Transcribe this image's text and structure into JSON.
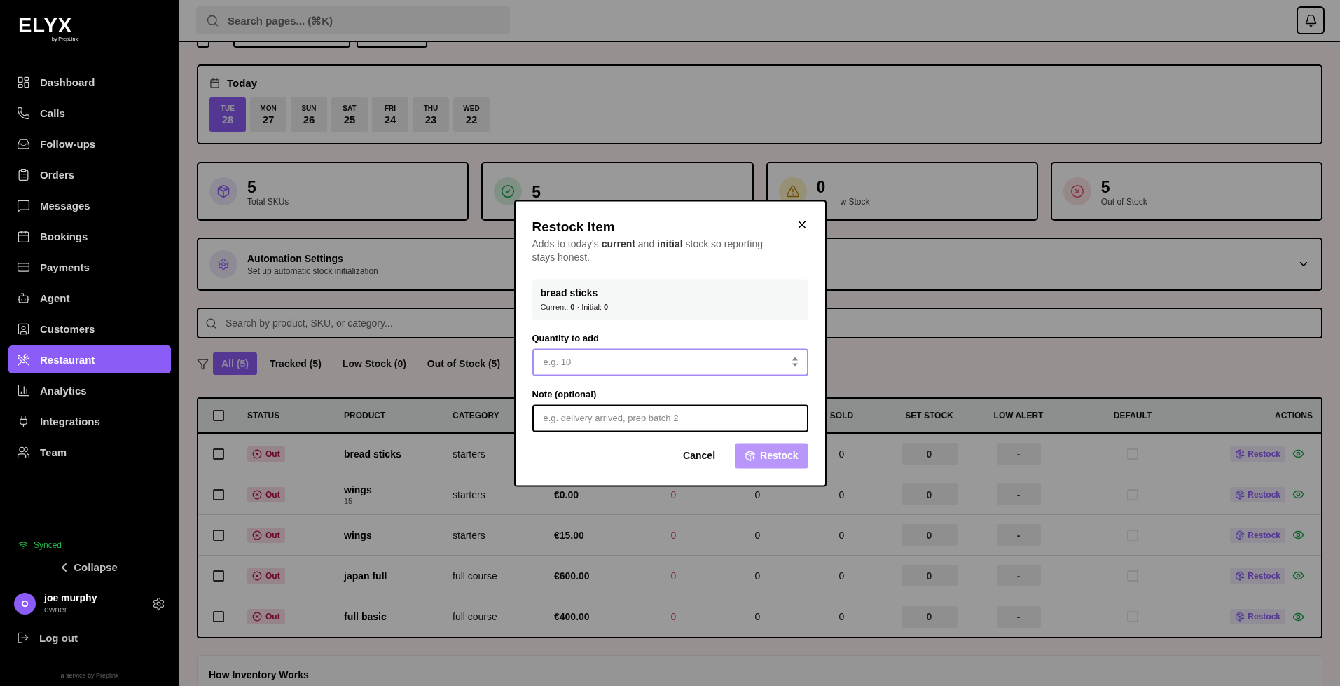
{
  "sidebar": {
    "logo": "ELYX",
    "logo_sub": "by PrepLink",
    "items": [
      {
        "label": "Dashboard",
        "selected": false
      },
      {
        "label": "Calls",
        "selected": false
      },
      {
        "label": "Follow-ups",
        "selected": false
      },
      {
        "label": "Orders",
        "selected": false
      },
      {
        "label": "Messages",
        "selected": false
      },
      {
        "label": "Bookings",
        "selected": false
      },
      {
        "label": "Payments",
        "selected": false
      },
      {
        "label": "Agent",
        "selected": false
      },
      {
        "label": "Customers",
        "selected": false
      },
      {
        "label": "Restaurant",
        "selected": true
      },
      {
        "label": "Analytics",
        "selected": false
      },
      {
        "label": "Integrations",
        "selected": false
      },
      {
        "label": "Team",
        "selected": false
      }
    ],
    "sync_status": "Synced",
    "collapse": "Collapse",
    "user": {
      "initial": "O",
      "name": "joe murphy",
      "role": "owner"
    },
    "logout": "Log out",
    "footer": "a service by Preplink"
  },
  "header": {
    "search_placeholder": "Search pages... (⌘K)"
  },
  "today": {
    "title": "Today",
    "days": [
      {
        "weekday": "TUE",
        "date": "28",
        "selected": true
      },
      {
        "weekday": "MON",
        "date": "27",
        "selected": false
      },
      {
        "weekday": "SUN",
        "date": "26",
        "selected": false
      },
      {
        "weekday": "SAT",
        "date": "25",
        "selected": false
      },
      {
        "weekday": "FRI",
        "date": "24",
        "selected": false
      },
      {
        "weekday": "THU",
        "date": "23",
        "selected": false
      },
      {
        "weekday": "WED",
        "date": "22",
        "selected": false
      }
    ]
  },
  "stats": [
    {
      "kind": "total",
      "value": "5",
      "label": "Total SKUs"
    },
    {
      "kind": "tracked",
      "value": "5"
    },
    {
      "kind": "low",
      "value": "0",
      "label": "w Stock"
    },
    {
      "kind": "out",
      "value": "5",
      "label": "Out of Stock"
    }
  ],
  "automation": {
    "title": "Automation Settings",
    "subtitle": "Set up automatic stock initialization",
    "expanded": false
  },
  "product_search": {
    "placeholder": "Search by product, SKU, or category..."
  },
  "filters": [
    {
      "label": "All (5)",
      "selected": true
    },
    {
      "label": "Tracked (5)",
      "selected": false
    },
    {
      "label": "Low Stock (0)",
      "selected": false
    },
    {
      "label": "Out of Stock (5)",
      "selected": false
    }
  ],
  "table": {
    "all_checked": false,
    "columns": {
      "status": "STATUS",
      "product": "PRODUCT",
      "category": "CATEGORY",
      "sold": "SOLD",
      "set_stock": "SET STOCK",
      "low_alert": "LOW ALERT",
      "default": "DEFAULT",
      "actions": "ACTIONS"
    },
    "rows": [
      {
        "checked": false,
        "status": "Out",
        "product": "bread sticks",
        "category": "starters",
        "sold": "0",
        "set_stock": "0",
        "low_alert": "-",
        "default": false,
        "action": "Restock"
      },
      {
        "checked": false,
        "status": "Out",
        "product": "wings",
        "sku": "15",
        "category": "starters",
        "column_5": "€0.00",
        "column_6": "0",
        "column_7": "0",
        "sold": "0",
        "set_stock": "0",
        "low_alert": "-",
        "default": false,
        "action": "Restock"
      },
      {
        "checked": false,
        "status": "Out",
        "product": "wings",
        "category": "starters",
        "column_5": "€15.00",
        "column_6": "0",
        "column_7": "0",
        "sold": "0",
        "set_stock": "0",
        "low_alert": "-",
        "default": false,
        "action": "Restock"
      },
      {
        "checked": false,
        "status": "Out",
        "product": "japan full",
        "category": "full course",
        "column_5": "€600.00",
        "column_6": "0",
        "column_7": "0",
        "sold": "0",
        "set_stock": "0",
        "low_alert": "-",
        "default": false,
        "action": "Restock"
      },
      {
        "checked": false,
        "status": "Out",
        "product": "full basic",
        "category": "full course",
        "column_5": "€400.00",
        "column_6": "0",
        "column_7": "0",
        "sold": "0",
        "set_stock": "0",
        "low_alert": "-",
        "default": false,
        "action": "Restock"
      }
    ]
  },
  "info_card": {
    "title": "How Inventory Works"
  },
  "modal": {
    "title": "Restock item",
    "description": "Adds to today's **current** and **initial** stock so reporting stays honest.",
    "item_name": "bread sticks",
    "item_stats": "Current: **0** · Initial: **0**",
    "quantity_label": "Quantity to add",
    "quantity_placeholder": "e.g. 10",
    "quantity_focused": true,
    "note_label": "Note (optional)",
    "note_placeholder": "e.g. delivery arrived, prep batch 2",
    "cancel": "Cancel",
    "submit": "Restock",
    "submit_disabled": true
  }
}
